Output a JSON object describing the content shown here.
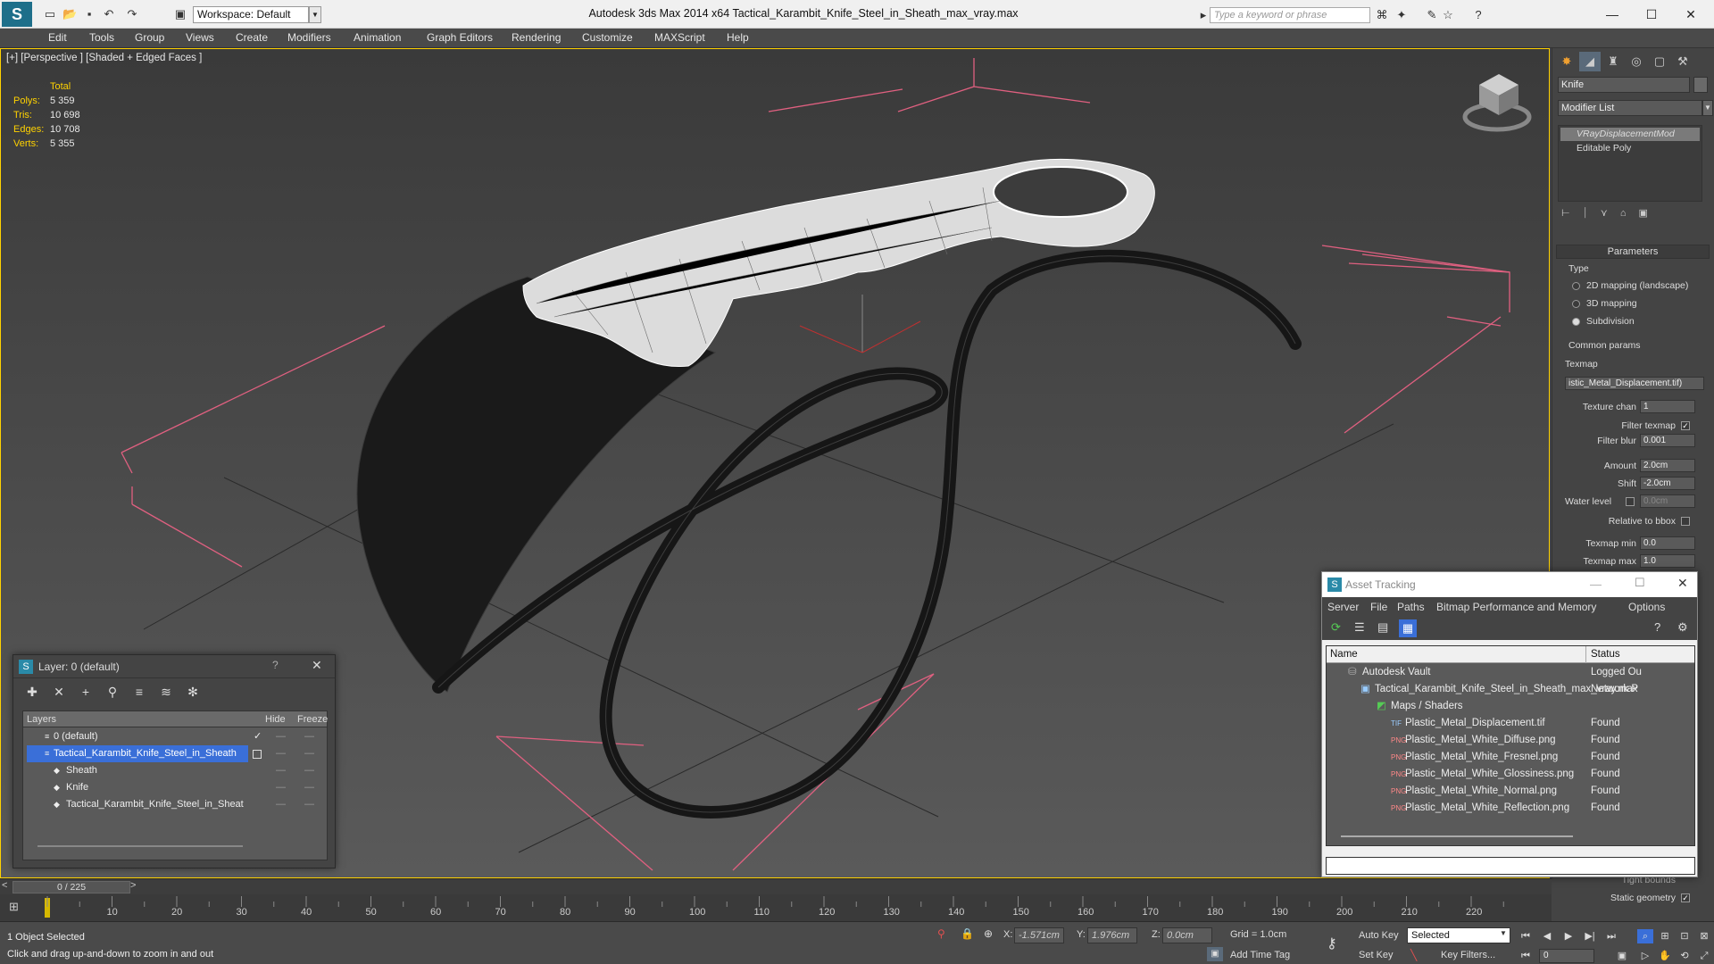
{
  "titlebar": {
    "workspace": "Workspace: Default",
    "title": "Autodesk 3ds Max  2014 x64     Tactical_Karambit_Knife_Steel_in_Sheath_max_vray.max",
    "search_placeholder": "Type a keyword or phrase"
  },
  "menu": [
    "Edit",
    "Tools",
    "Group",
    "Views",
    "Create",
    "Modifiers",
    "Animation",
    "Graph Editors",
    "Rendering",
    "Customize",
    "MAXScript",
    "Help"
  ],
  "viewport": {
    "label": "[+] [Perspective ] [Shaded + Edged Faces ]",
    "stats": {
      "header": "Total",
      "rows": [
        {
          "label": "Polys:",
          "value": "5 359"
        },
        {
          "label": "Tris:",
          "value": "10 698"
        },
        {
          "label": "Edges:",
          "value": "10 708"
        },
        {
          "label": "Verts:",
          "value": "5 355"
        }
      ]
    }
  },
  "command_panel": {
    "object_name": "Knife",
    "modifier_list": "Modifier List",
    "stack": [
      "VRayDisplacementMod",
      "Editable Poly"
    ],
    "rollout_title": "Parameters",
    "type_label": "Type",
    "type_options": [
      "2D mapping (landscape)",
      "3D mapping",
      "Subdivision"
    ],
    "common_label": "Common params",
    "texmap_label": "Texmap",
    "texmap_value": "istic_Metal_Displacement.tif)",
    "texture_chan_label": "Texture chan",
    "texture_chan_value": "1",
    "filter_texmap_label": "Filter texmap",
    "filter_blur_label": "Filter blur",
    "filter_blur_value": "0.001",
    "amount_label": "Amount",
    "amount_value": "2.0cm",
    "shift_label": "Shift",
    "shift_value": "-2.0cm",
    "water_label": "Water level",
    "water_value": "0.0cm",
    "rel_bbox_label": "Relative to bbox",
    "texmap_min_label": "Texmap min",
    "texmap_min_value": "0.0",
    "texmap_max_label": "Texmap max",
    "texmap_max_value": "1.0",
    "tight_bounds_label": "Tight bounds",
    "static_geom_label": "Static geometry"
  },
  "layer_dialog": {
    "title": "Layer: 0 (default)",
    "help": "?",
    "col_layers": "Layers",
    "col_hide": "Hide",
    "col_freeze": "Freeze",
    "rows": [
      {
        "name": "0 (default)",
        "indent": 1
      },
      {
        "name": "Tactical_Karambit_Knife_Steel_in_Sheath",
        "indent": 1,
        "selected": true
      },
      {
        "name": "Sheath",
        "indent": 2
      },
      {
        "name": "Knife",
        "indent": 2
      },
      {
        "name": "Tactical_Karambit_Knife_Steel_in_Sheat",
        "indent": 2
      }
    ]
  },
  "asset_tracking": {
    "title": "Asset Tracking",
    "menu": [
      "Server",
      "File",
      "Paths",
      "Bitmap Performance and Memory",
      "Options"
    ],
    "col_name": "Name",
    "col_status": "Status",
    "rows": [
      {
        "name": "Autodesk Vault",
        "status": "Logged Ou",
        "indent": 1
      },
      {
        "name": "Tactical_Karambit_Knife_Steel_in_Sheath_max_vray.max",
        "status": "Network P",
        "indent": 2
      },
      {
        "name": "Maps / Shaders",
        "status": "",
        "indent": 3
      },
      {
        "name": "Plastic_Metal_Displacement.tif",
        "status": "Found",
        "indent": 4
      },
      {
        "name": "Plastic_Metal_White_Diffuse.png",
        "status": "Found",
        "indent": 4
      },
      {
        "name": "Plastic_Metal_White_Fresnel.png",
        "status": "Found",
        "indent": 4
      },
      {
        "name": "Plastic_Metal_White_Glossiness.png",
        "status": "Found",
        "indent": 4
      },
      {
        "name": "Plastic_Metal_White_Normal.png",
        "status": "Found",
        "indent": 4
      },
      {
        "name": "Plastic_Metal_White_Reflection.png",
        "status": "Found",
        "indent": 4
      }
    ]
  },
  "timeline": {
    "frame": "0 / 225",
    "ticks": [
      "10",
      "20",
      "30",
      "40",
      "50",
      "60",
      "70",
      "80",
      "90",
      "100",
      "110",
      "120",
      "130",
      "140",
      "150",
      "160",
      "170",
      "180",
      "190",
      "200",
      "210",
      "220"
    ]
  },
  "status": {
    "selection": "1 Object Selected",
    "prompt": "Click and drag up-and-down to zoom in and out",
    "x_label": "X:",
    "x_value": "-1.571cm",
    "y_label": "Y:",
    "y_value": "1.976cm",
    "z_label": "Z:",
    "z_value": "0.0cm",
    "grid": "Grid = 1.0cm",
    "add_time_tag": "Add Time Tag",
    "auto_key": "Auto Key",
    "set_key": "Set Key",
    "selected": "Selected",
    "key_filters": "Key Filters...",
    "frame_value": "0"
  },
  "colors": {
    "accent_yellow": "#ffd200",
    "selection_blue": "#3a6fd8",
    "grid_pink": "#e06080"
  }
}
